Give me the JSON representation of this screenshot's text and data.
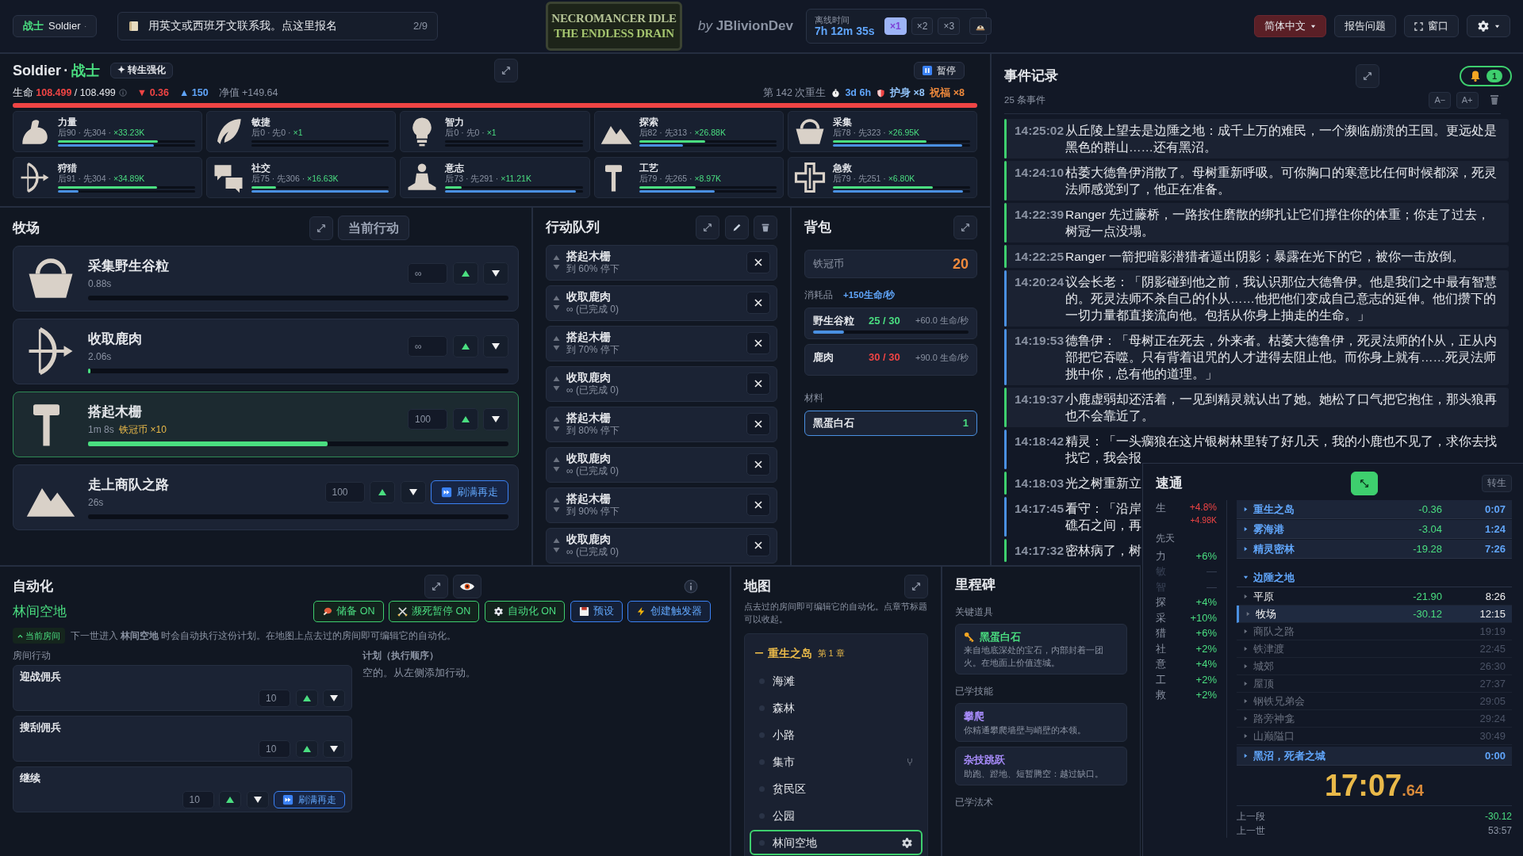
{
  "topbar": {
    "class_select": {
      "cn": "战士",
      "en": "Soldier"
    },
    "notice": {
      "text": "用英文或西班牙文联系我。",
      "link": "点这里报名",
      "count": "2/9"
    },
    "logo": {
      "line1": "NECROMANCER IDLE",
      "line2": "THE ENDLESS DRAIN"
    },
    "byline": "*by* **JBlivionDev**",
    "offline": {
      "label": "离线时间",
      "time": "7h 12m 35s",
      "speeds": [
        {
          "label": "×1",
          "selected": true
        },
        {
          "label": "×2",
          "selected": false
        },
        {
          "label": "×3",
          "selected": false
        }
      ]
    },
    "language": "简体中文",
    "report": "报告问题",
    "window": "窗口"
  },
  "character": {
    "name": "Soldier",
    "sep": "·",
    "class": "战士",
    "rebirth_button": "✦ 转生强化",
    "pause": "暂停",
    "life_label": "生命",
    "life": "108.499",
    "life_max": "/ 108.499",
    "drain": "▼ 0.36",
    "gain": "▲ 150",
    "net_label": "净值",
    "net": "+149.64",
    "rebirth_count": "第 142 次重生",
    "timer": "3d 6h",
    "amulet": "护身 ×8",
    "blessing": "祝福 ×8",
    "life_bar": {
      "level": 1
    }
  },
  "stats": [
    {
      "name": "力量",
      "detail": "后90 · 先304 · ",
      "mult": "×33.23K",
      "bars": [
        {
          "kind": "current",
          "level": 0.73
        },
        {
          "kind": "base",
          "level": 0.7
        }
      ]
    },
    {
      "name": "敏捷",
      "detail": "后0 · 先0 · ",
      "mult": "×1",
      "bars": [
        {
          "kind": "current",
          "level": 0
        },
        {
          "kind": "base",
          "level": 0
        }
      ]
    },
    {
      "name": "智力",
      "detail": "后0 · 先0 · ",
      "mult": "×1",
      "bars": [
        {
          "kind": "current",
          "level": 0
        },
        {
          "kind": "base",
          "level": 0
        }
      ]
    },
    {
      "name": "探索",
      "detail": "后82 · 先313 · ",
      "mult": "×26.88K",
      "bars": [
        {
          "kind": "current",
          "level": 0.48
        },
        {
          "kind": "base",
          "level": 0.32
        }
      ]
    },
    {
      "name": "采集",
      "detail": "后78 · 先323 · ",
      "mult": "×26.95K",
      "bars": [
        {
          "kind": "current",
          "level": 0.68
        },
        {
          "kind": "base",
          "level": 0.94
        }
      ]
    },
    {
      "name": "狩猎",
      "detail": "后91 · 先304 · ",
      "mult": "×34.89K",
      "bars": [
        {
          "kind": "current",
          "level": 0.72
        },
        {
          "kind": "base",
          "level": 0.15
        }
      ]
    },
    {
      "name": "社交",
      "detail": "后75 · 先306 · ",
      "mult": "×16.63K",
      "bars": [
        {
          "kind": "current",
          "level": 0.18
        },
        {
          "kind": "base",
          "level": 1
        }
      ]
    },
    {
      "name": "意志",
      "detail": "后73 · 先291 · ",
      "mult": "×11.21K",
      "bars": [
        {
          "kind": "current",
          "level": 0.12
        },
        {
          "kind": "base",
          "level": 0.95
        }
      ]
    },
    {
      "name": "工艺",
      "detail": "后79 · 先265 · ",
      "mult": "×8.97K",
      "bars": [
        {
          "kind": "current",
          "level": 0.41
        },
        {
          "kind": "base",
          "level": 0.55
        }
      ]
    },
    {
      "name": "急救",
      "detail": "后79 · 先251 · ",
      "mult": "×6.80K",
      "bars": [
        {
          "kind": "current",
          "level": 0.73
        },
        {
          "kind": "base",
          "level": 0.95
        }
      ]
    }
  ],
  "location": {
    "title": "牧场",
    "current_button": "当前行动",
    "actions": [
      {
        "name": "采集野生谷粒",
        "time": "0.88s",
        "qty": "∞",
        "selected": false,
        "level": 0
      },
      {
        "name": "收取鹿肉",
        "time": "2.06s",
        "qty": "∞",
        "selected": false,
        "level": 0.005
      },
      {
        "name": "搭起木栅",
        "time": "1m 8s",
        "reward": "铁冠币 ×10",
        "qty": "100",
        "selected": true,
        "level": 0.57
      },
      {
        "name": "走上商队之路",
        "time": "26s",
        "qty": "100",
        "selected": false,
        "level": 0,
        "refill": "刷满再走"
      }
    ]
  },
  "queue": {
    "title": "行动队列",
    "items": [
      {
        "name": "搭起木栅",
        "detail": "到 60% 停下"
      },
      {
        "name": "收取鹿肉",
        "detail": "∞ (已完成 0)"
      },
      {
        "name": "搭起木栅",
        "detail": "到 70% 停下"
      },
      {
        "name": "收取鹿肉",
        "detail": "∞ (已完成 0)"
      },
      {
        "name": "搭起木栅",
        "detail": "到 80% 停下"
      },
      {
        "name": "收取鹿肉",
        "detail": "∞ (已完成 0)"
      },
      {
        "name": "搭起木栅",
        "detail": "到 90% 停下"
      },
      {
        "name": "收取鹿肉",
        "detail": "∞ (已完成 0)"
      }
    ]
  },
  "bag": {
    "title": "背包",
    "currency": {
      "name": "铁冠币",
      "amount": "20"
    },
    "consumables_label": "消耗品",
    "consumables_rate": "+150生命/秒",
    "consumables": [
      {
        "name": "野生谷粒",
        "count": "25 / 30",
        "full": false,
        "rate": "+60.0 生命/秒",
        "level": 0.2
      },
      {
        "name": "鹿肉",
        "count": "30 / 30",
        "full": true,
        "rate": "+90.0 生命/秒"
      }
    ],
    "materials_label": "材料",
    "materials": [
      {
        "name": "黑蛋白石",
        "count": "1"
      }
    ]
  },
  "log": {
    "title": "事件记录",
    "count": "25 条事件",
    "alerts": "1",
    "font_smaller": "A−",
    "font_larger": "A+",
    "events": [
      {
        "time": "14:25:02",
        "color": "#3ecf6e",
        "text": "从丘陵上望去是边陲之地：成千上万的难民，一个濒临崩溃的王国。更远处是黑色的群山……还有黑沼。"
      },
      {
        "time": "14:24:10",
        "color": "#3ecf6e",
        "text": "枯萎大德鲁伊消散了。母树重新呼吸。可你胸口的寒意比任何时候都深，死灵法师感觉到了，他正在准备。"
      },
      {
        "time": "14:22:39",
        "color": "#3ecf6e",
        "text": "Ranger 先过藤桥，一路按住磨散的绑扎让它们撑住你的体重；你走了过去，树冠一点没塌。"
      },
      {
        "time": "14:22:25",
        "color": "#3ecf6e",
        "text": "Ranger 一箭把暗影潜猎者逼出阴影；暴露在光下的它，被你一击放倒。"
      },
      {
        "time": "14:20:24",
        "color": "#4a90e2",
        "text": "议会长老：「阴影碰到他之前，我认识那位大德鲁伊。他是我们之中最有智慧的。死灵法师不杀自己的仆从……他把他们变成自己意志的延伸。他们攒下的一切力量都直接流向他。包括从你身上抽走的生命。」"
      },
      {
        "time": "14:19:53",
        "color": "#4a90e2",
        "text": "德鲁伊：「母树正在死去，外来者。枯萎大德鲁伊，死灵法师的仆从，正从内部把它吞噬。只有背着诅咒的人才进得去阻止他。而你身上就有……死灵法师挑中你，总有他的道理。」"
      },
      {
        "time": "14:19:37",
        "color": "#3ecf6e",
        "text": "小鹿虚弱却还活着，一见到精灵就认出了她。她松了口气把它抱住，那头狼再也不会靠近了。"
      },
      {
        "time": "14:18:42",
        "color": "#4a90e2",
        "kind": "covered",
        "lines": [
          "精灵：「一头瘸狼在这片银树林里转了好几天，我的小鹿也不见了，求你去找",
          "找它，我会报"
        ]
      },
      {
        "time": "14:18:03",
        "color": "#3ecf6e",
        "kind": "covered",
        "lines": [
          "光之树重新立"
        ]
      },
      {
        "time": "14:17:45",
        "color": "#4a90e2",
        "kind": "covered",
        "lines": [
          "看守：「沿岸",
          "礁石之间，再"
        ]
      },
      {
        "time": "14:17:32",
        "color": "#3ecf6e",
        "kind": "covered",
        "lines": [
          "密林病了，树"
        ]
      }
    ]
  },
  "automation": {
    "title": "自动化",
    "room": "林间空地",
    "buttons": [
      {
        "kind": "toggle",
        "label": "储备 ON"
      },
      {
        "kind": "toggle",
        "label": "濒死暂停 ON"
      },
      {
        "kind": "toggle",
        "label": "自动化 ON"
      },
      {
        "kind": "action",
        "label": "预设"
      },
      {
        "kind": "action",
        "label": "创建触发器"
      }
    ],
    "room_tag": "当前房间",
    "description": "下一世进入 **林间空地** 时会自动执行这份计划。在地图上点去过的房间即可编辑它的自动化。",
    "actions_label": "房间行动",
    "actions": [
      {
        "name": "迎战佣兵",
        "qty": "10"
      },
      {
        "name": "搜刮佣兵",
        "qty": "10"
      },
      {
        "name": "继续",
        "qty": "10",
        "refill": "刷满再走"
      }
    ],
    "plan_label": "计划（执行顺序）",
    "plan_empty": "空的。从左侧添加行动。"
  },
  "map": {
    "title": "地图",
    "hint": "点去过的房间即可编辑它的自动化。点章节标题可以收起。",
    "chapter": {
      "name": "重生之岛",
      "number": "第 1 章",
      "expanded": true
    },
    "rooms": [
      {
        "name": "海滩",
        "selected": false
      },
      {
        "name": "森林",
        "selected": false
      },
      {
        "name": "小路",
        "selected": false
      },
      {
        "name": "集市",
        "selected": false,
        "fork": true
      },
      {
        "name": "贫民区",
        "selected": false
      },
      {
        "name": "公园",
        "selected": false
      },
      {
        "name": "林间空地",
        "selected": true
      }
    ]
  },
  "milestones": {
    "title": "里程碑",
    "key_items_label": "关键道具",
    "key_items": [
      {
        "name": "黑蛋白石",
        "description": "来自地底深处的宝石，内部封着一团火。在地面上价值连城。"
      }
    ],
    "skills_label": "已学技能",
    "skills": [
      {
        "name": "攀爬",
        "description": "你精通攀爬墙壁与峭壁的本领。"
      },
      {
        "name": "杂技跳跃",
        "description": "助跑、蹬地、短暂腾空：越过缺口。"
      }
    ],
    "spells_label": "已学法术"
  },
  "speedrun": {
    "title": "速通",
    "rebirth": "转生",
    "life_label": "生",
    "life_pct": "+4.8%",
    "life_abs": "+4.98K",
    "innate_label": "先天",
    "bonuses": [
      {
        "label": "力",
        "value": "+6%",
        "active": true
      },
      {
        "label": "敏",
        "value": "—",
        "active": false
      },
      {
        "label": "智",
        "value": "—",
        "active": false
      },
      {
        "label": "探",
        "value": "+4%",
        "active": true
      },
      {
        "label": "采",
        "value": "+10%",
        "active": true
      },
      {
        "label": "猎",
        "value": "+6%",
        "active": true
      },
      {
        "label": "社",
        "value": "+2%",
        "active": true
      },
      {
        "label": "意",
        "value": "+4%",
        "active": true
      },
      {
        "label": "工",
        "value": "+2%",
        "active": true
      },
      {
        "label": "救",
        "value": "+2%",
        "active": true
      }
    ],
    "splits": [
      {
        "name": "重生之岛",
        "delta": "-0.36",
        "time": "0:07",
        "expanded": false
      },
      {
        "name": "雾海港",
        "delta": "-3.04",
        "time": "1:24",
        "expanded": false
      },
      {
        "name": "精灵密林",
        "delta": "-19.28",
        "time": "7:26",
        "expanded": false
      },
      {
        "name": "边陲之地",
        "expanded": true,
        "children": [
          {
            "name": "平原",
            "delta": "-21.90",
            "time": "8:26",
            "kind": "done"
          },
          {
            "name": "牧场",
            "delta": "-30.12",
            "time": "12:15",
            "kind": "current"
          },
          {
            "name": "商队之路",
            "time": "19:19",
            "kind": "pending"
          },
          {
            "name": "铁津渡",
            "time": "22:45",
            "kind": "pending"
          },
          {
            "name": "城郊",
            "time": "26:30",
            "kind": "pending"
          },
          {
            "name": "屋顶",
            "time": "27:37",
            "kind": "pending"
          },
          {
            "name": "钢铁兄弟会",
            "time": "29:05",
            "kind": "pending"
          },
          {
            "name": "路旁神龛",
            "time": "29:24",
            "kind": "pending"
          },
          {
            "name": "山巅隘口",
            "time": "30:49",
            "kind": "pending"
          }
        ]
      },
      {
        "name": "黑沼，死者之城",
        "time": "0:00",
        "expanded": false
      }
    ],
    "clock": "17:07",
    "clock_fraction": ".64",
    "last_segment_label": "上一段",
    "last_segment": "-30.12",
    "last_life_label": "上一世",
    "last_life": "53:57"
  }
}
